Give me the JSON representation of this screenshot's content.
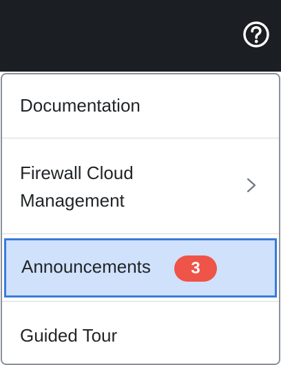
{
  "header": {
    "help_icon": "question-circle-icon"
  },
  "menu": {
    "items": [
      {
        "label": "Documentation"
      },
      {
        "label": "Firewall Cloud\nManagement",
        "has_submenu": true,
        "submenu_icon": "chevron-right-icon"
      },
      {
        "label": "Announcements",
        "badge": "3",
        "selected": true
      },
      {
        "label": "Guided Tour"
      }
    ]
  },
  "colors": {
    "topbar": "#1b1e22",
    "selected_bg": "#cfe1fb",
    "selected_border": "#3a7ad8",
    "badge_bg": "#ee5448"
  }
}
